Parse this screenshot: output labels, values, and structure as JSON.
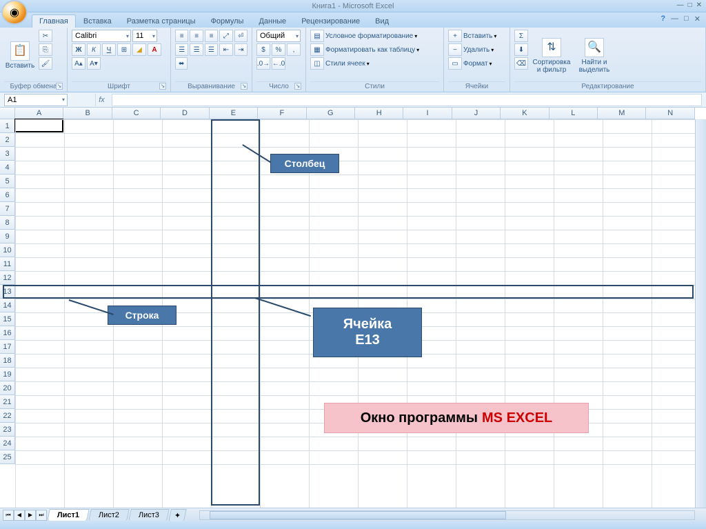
{
  "title": "Книга1 - Microsoft Excel",
  "tabs": [
    "Главная",
    "Вставка",
    "Разметка страницы",
    "Формулы",
    "Данные",
    "Рецензирование",
    "Вид"
  ],
  "active_tab": 0,
  "ribbon": {
    "clipboard": {
      "label": "Буфер обмена",
      "paste": "Вставить"
    },
    "font": {
      "label": "Шрифт",
      "name": "Calibri",
      "size": "11"
    },
    "alignment": {
      "label": "Выравнивание"
    },
    "number": {
      "label": "Число",
      "format": "Общий"
    },
    "styles": {
      "label": "Стили",
      "cond": "Условное форматирование",
      "table": "Форматировать как таблицу",
      "cell": "Стили ячеек"
    },
    "cells": {
      "label": "Ячейки",
      "insert": "Вставить",
      "delete": "Удалить",
      "format": "Формат"
    },
    "editing": {
      "label": "Редактирование",
      "sort": "Сортировка и фильтр",
      "find": "Найти и выделить"
    }
  },
  "name_box": "A1",
  "fx": "fx",
  "columns": [
    "A",
    "B",
    "C",
    "D",
    "E",
    "F",
    "G",
    "H",
    "I",
    "J",
    "K",
    "L",
    "M",
    "N"
  ],
  "rows": [
    "1",
    "2",
    "3",
    "4",
    "5",
    "6",
    "7",
    "8",
    "9",
    "10",
    "11",
    "12",
    "13",
    "14",
    "15",
    "16",
    "17",
    "18",
    "19",
    "20",
    "21",
    "22",
    "23",
    "24",
    "25"
  ],
  "sheets": [
    "Лист1",
    "Лист2",
    "Лист3"
  ],
  "active_sheet": 0,
  "annotations": {
    "column_label": "Столбец",
    "row_label": "Строка",
    "cell_label_1": "Ячейка",
    "cell_label_2": "E13",
    "title_black": "Окно программы ",
    "title_red": "MS EXCEL"
  }
}
